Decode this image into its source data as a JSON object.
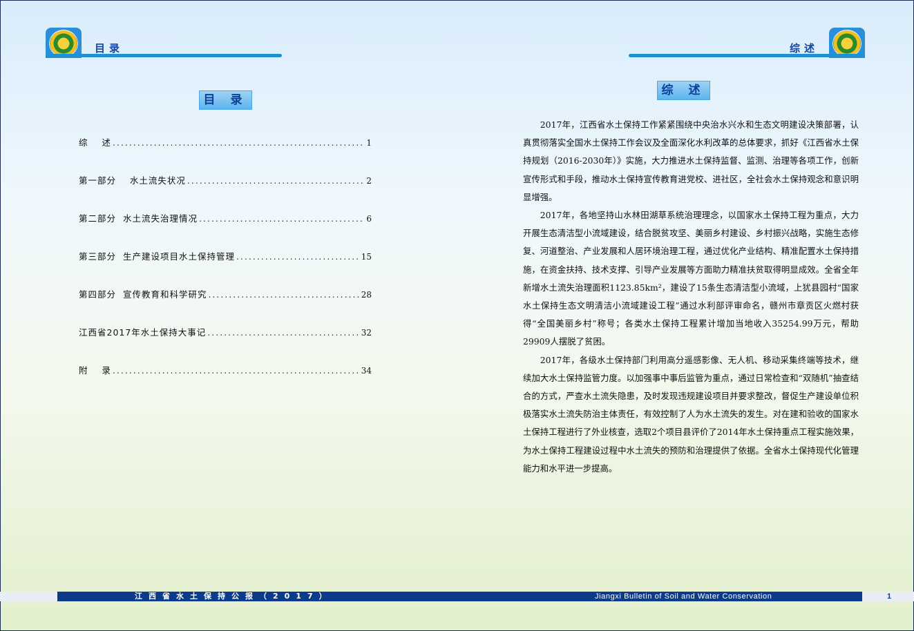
{
  "left_header": {
    "title": "目录"
  },
  "right_header": {
    "title": "综述"
  },
  "toc": {
    "heading": "目 录",
    "items": [
      {
        "label": "综    述",
        "page": "1"
      },
      {
        "label": "第一部分    水土流失状况",
        "page": "2"
      },
      {
        "label": "第二部分  水土流失治理情况",
        "page": "6"
      },
      {
        "label": "第三部分  生产建设项目水土保持管理",
        "page": "15"
      },
      {
        "label": "第四部分  宣传教育和科学研究",
        "page": "28"
      },
      {
        "label": "江西省2017年水土保持大事记",
        "page": "32"
      },
      {
        "label": "附    录",
        "page": "34"
      }
    ]
  },
  "summary": {
    "heading": "综 述",
    "paragraphs": [
      "2017年，江西省水土保持工作紧紧围绕中央治水兴水和生态文明建设决策部署，认真贯彻落实全国水土保持工作会议及全面深化水利改革的总体要求，抓好《江西省水土保持规划（2016-2030年）》实施，大力推进水土保持监督、监测、治理等各项工作，创新宣传形式和手段，推动水土保持宣传教育进党校、进社区，全社会水土保持观念和意识明显增强。",
      "2017年，各地坚持山水林田湖草系统治理理念，以国家水土保持工程为重点，大力开展生态清洁型小流域建设，结合脱贫攻坚、美丽乡村建设、乡村振兴战略，实施生态修复、河道整治、产业发展和人居环境治理工程，通过优化产业结构、精准配置水土保持措施，在资金扶持、技术支撑、引导产业发展等方面助力精准扶贫取得明显成效。全省全年新增水土流失治理面积1123.85km²，建设了15条生态清洁型小流域，上犹县园村“国家水土保持生态文明清洁小流域建设工程”通过水利部评审命名，赣州市章贡区火燃村获得“全国美丽乡村”称号；各类水土保持工程累计增加当地收入35254.99万元，帮助29909人摆脱了贫困。",
      "2017年，各级水土保持部门利用高分遥感影像、无人机、移动采集终端等技术，继续加大水土保持监管力度。以加强事中事后监管为重点，通过日常检查和“双随机”抽查结合的方式，严查水土流失隐患，及时发现违规建设项目并要求整改，督促生产建设单位积极落实水土流失防治主体责任，有效控制了人为水土流失的发生。对在建和验收的国家水土保持工程进行了外业核查，选取2个项目县评价了2014年水土保持重点工程实施效果，为水土保持工程建设过程中水土流失的预防和治理提供了依据。全省水土保持现代化管理能力和水平进一步提高。"
    ]
  },
  "footer": {
    "cn_title": "江西省水土保持公报（2017）",
    "en_title": "Jiangxi Bulletin of Soil and Water Conservation",
    "page_number": "1"
  },
  "colors": {
    "accent": "#1f8fd6",
    "footer": "#0d3b8c",
    "title_text": "#1446a0"
  }
}
